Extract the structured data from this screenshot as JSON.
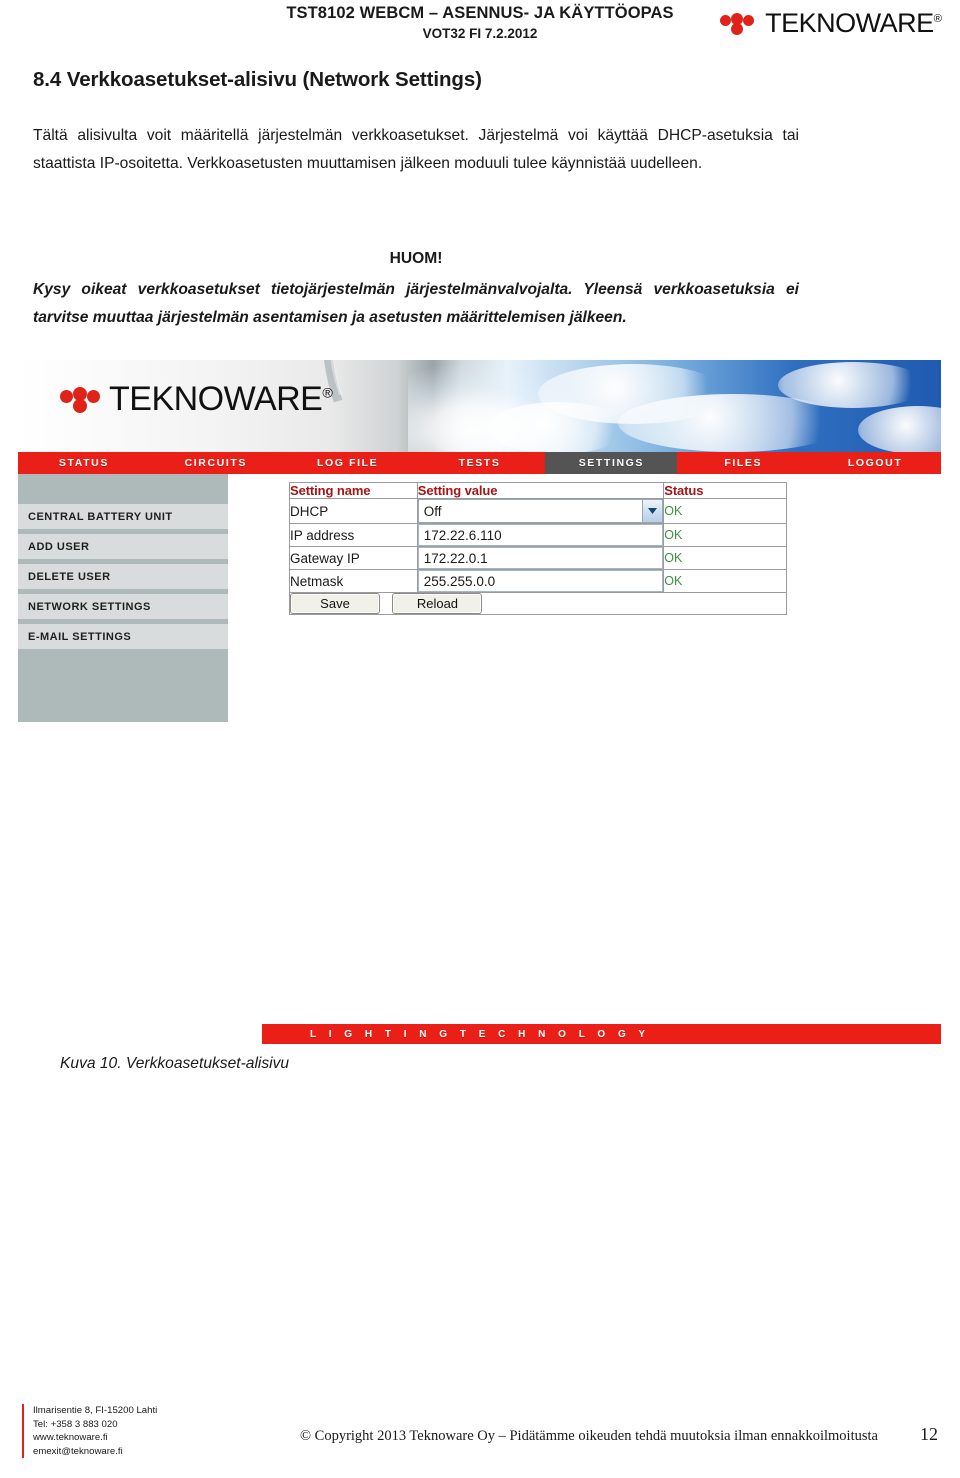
{
  "doc_header": {
    "title": "TST8102 WEBCM – ASENNUS- JA KÄYTTÖOPAS",
    "subtitle": "VOT32 FI 7.2.2012",
    "logo_text": "TEKNOWARE",
    "logo_reg": "®"
  },
  "section": {
    "number_title": "8.4 Verkkoasetukset-alisivu (Network Settings)",
    "intro": "Tältä alisivulta voit määritellä järjestelmän verkkoasetukset. Järjestelmä voi käyttää DHCP-asetuksia tai staattista IP-osoitetta. Verkkoasetusten muuttamisen jälkeen moduuli tulee käynnistää uudelleen.",
    "note_heading": "HUOM!",
    "note_body": "Kysy oikeat verkkoasetukset tietojärjestelmän järjestelmänvalvojalta. Yleensä verkkoasetuksia ei tarvitse muuttaa järjestelmän asentamisen ja asetusten määrittelemisen jälkeen.",
    "figure_caption": "Kuva 10.  Verkkoasetukset-alisivu"
  },
  "screenshot": {
    "banner_logo_text": "TEKNOWARE",
    "banner_logo_reg": "®",
    "nav": [
      {
        "label": "STATUS",
        "active": false
      },
      {
        "label": "CIRCUITS",
        "active": false
      },
      {
        "label": "LOG FILE",
        "active": false
      },
      {
        "label": "TESTS",
        "active": false
      },
      {
        "label": "SETTINGS",
        "active": true
      },
      {
        "label": "FILES",
        "active": false
      },
      {
        "label": "LOGOUT",
        "active": false
      }
    ],
    "sidebar": [
      "CENTRAL BATTERY UNIT",
      "ADD USER",
      "DELETE USER",
      "NETWORK SETTINGS",
      "E-MAIL SETTINGS"
    ],
    "table": {
      "headers": [
        "Setting name",
        "Setting value",
        "Status"
      ],
      "rows": [
        {
          "name": "DHCP",
          "value": "Off",
          "type": "select",
          "status": "OK"
        },
        {
          "name": "IP address",
          "value": "172.22.6.110",
          "type": "text",
          "status": "OK"
        },
        {
          "name": "Gateway IP",
          "value": "172.22.0.1",
          "type": "text",
          "status": "OK"
        },
        {
          "name": "Netmask",
          "value": "255.255.0.0",
          "type": "text",
          "status": "OK"
        }
      ],
      "buttons": [
        "Save",
        "Reload"
      ]
    },
    "footer_bar": "L I G H T I N G    T E C H N O L O G Y"
  },
  "doc_footer": {
    "address_line1": "Ilmarisentie 8, FI-15200 Lahti",
    "address_line2": "Tel: +358 3 883 020",
    "address_line3": "www.teknoware.fi",
    "address_line4": "emexit@teknoware.fi",
    "copyright": "© Copyright 2013 Teknoware Oy – Pidätämme oikeuden tehdä muutoksia ilman ennakkoilmoitusta",
    "page_number": "12"
  },
  "colors": {
    "brand_red": "#ea2018",
    "logo_red": "#e0231a",
    "header_red": "#a51515",
    "status_green": "#3f8f3f",
    "active_tab": "#545454",
    "sidebar_dark": "#aeb9b9",
    "sidebar_item": "#d9dcdc"
  }
}
